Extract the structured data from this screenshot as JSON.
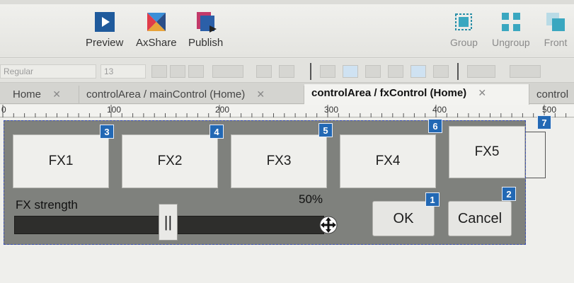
{
  "toolbar": {
    "preview_label": "Preview",
    "axshare_label": "AxShare",
    "publish_label": "Publish",
    "group_label": "Group",
    "ungroup_label": "Ungroup",
    "front_label": "Front"
  },
  "format": {
    "font_style": "Regular",
    "font_size": "13"
  },
  "tabs": [
    {
      "label": "Home"
    },
    {
      "label": "controlArea / mainControl (Home)"
    },
    {
      "label": "controlArea / fxControl (Home)"
    },
    {
      "label": "control"
    }
  ],
  "ruler": {
    "labels": [
      "0",
      "100",
      "200",
      "300",
      "400",
      "500"
    ]
  },
  "panel": {
    "fx_buttons": [
      {
        "label": "FX1",
        "badge": "3"
      },
      {
        "label": "FX2",
        "badge": "4"
      },
      {
        "label": "FX3",
        "badge": "5"
      },
      {
        "label": "FX4",
        "badge": "6"
      },
      {
        "label": "FX5",
        "badge": "7"
      }
    ],
    "strength_label": "FX strength",
    "strength_value_label": "50%",
    "strength_value": 0.5,
    "thumb_glyph": "||",
    "ok_label": "OK",
    "ok_badge": "1",
    "cancel_label": "Cancel",
    "cancel_badge": "2"
  },
  "colors": {
    "badge": "#2268b4",
    "panel": "#7f817d",
    "selection": "#3a4db0"
  }
}
